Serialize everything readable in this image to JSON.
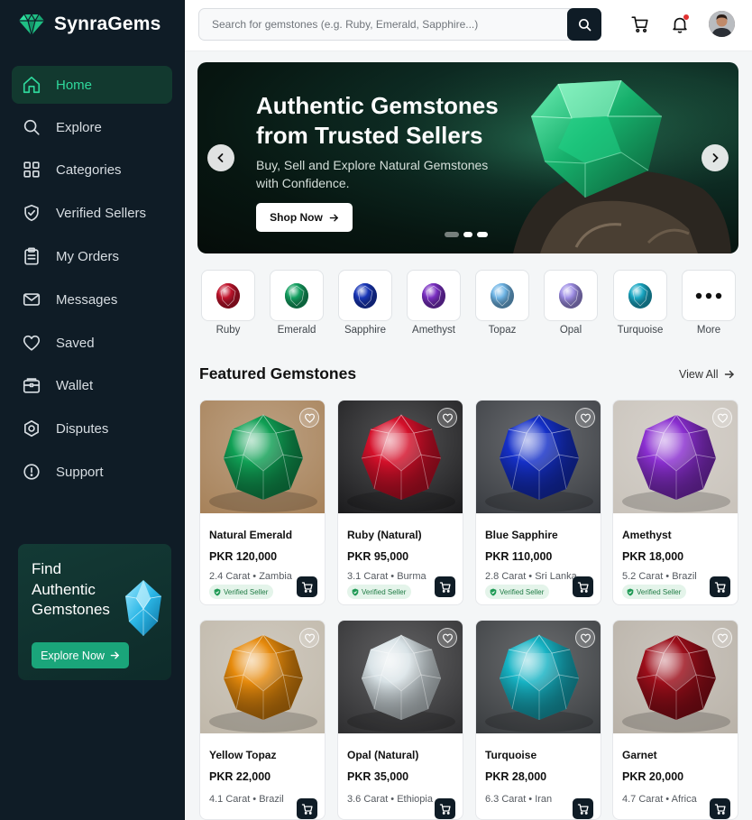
{
  "app": {
    "name": "SynraGems"
  },
  "sidebar": {
    "items": [
      {
        "label": "Home",
        "icon": "home-icon",
        "active": true
      },
      {
        "label": "Explore",
        "icon": "search-icon"
      },
      {
        "label": "Categories",
        "icon": "grid-icon"
      },
      {
        "label": "Verified Sellers",
        "icon": "shield-check-icon"
      },
      {
        "label": "My Orders",
        "icon": "clipboard-icon"
      },
      {
        "label": "Messages",
        "icon": "mail-icon"
      },
      {
        "label": "Saved",
        "icon": "heart-icon"
      },
      {
        "label": "Wallet",
        "icon": "wallet-icon"
      },
      {
        "label": "Disputes",
        "icon": "dispute-icon"
      },
      {
        "label": "Support",
        "icon": "info-icon"
      }
    ],
    "promo": {
      "title": "Find Authentic Gemstones",
      "button": "Explore Now"
    }
  },
  "header": {
    "search_placeholder": "Search for gemstones (e.g. Ruby, Emerald, Sapphire...)"
  },
  "hero": {
    "title": "Authentic Gemstones from Trusted Sellers",
    "subtitle": "Buy, Sell and Explore Natural Gemstones with Confidence.",
    "button": "Shop Now"
  },
  "categories": [
    {
      "label": "Ruby",
      "color": "#c0142c"
    },
    {
      "label": "Emerald",
      "color": "#14a061"
    },
    {
      "label": "Sapphire",
      "color": "#1836b8"
    },
    {
      "label": "Amethyst",
      "color": "#7a2fc2"
    },
    {
      "label": "Topaz",
      "color": "#6fb5e6"
    },
    {
      "label": "Opal",
      "color": "#9f8fe6"
    },
    {
      "label": "Turquoise",
      "color": "#1aa8c4"
    },
    {
      "label": "More",
      "color": "#111111"
    }
  ],
  "featured": {
    "title": "Featured Gemstones",
    "view_all": "View All",
    "products": [
      {
        "name": "Natural Emerald",
        "price": "PKR 120,000",
        "meta": "2.4 Carat • Zambia",
        "badge": "Verified Seller",
        "gem": "#10a055",
        "bg": "#a7825a"
      },
      {
        "name": "Ruby (Natural)",
        "price": "PKR 95,000",
        "meta": "3.1 Carat • Burma",
        "badge": "Verified Seller",
        "gem": "#d4102a",
        "bg": "#1c1c1e"
      },
      {
        "name": "Blue Sapphire",
        "price": "PKR 110,000",
        "meta": "2.8 Carat • Sri Lanka",
        "badge": "Verified Seller",
        "gem": "#1530c8",
        "bg": "#3a3d42"
      },
      {
        "name": "Amethyst",
        "price": "PKR 18,000",
        "meta": "5.2 Carat • Brazil",
        "badge": "Verified Seller",
        "gem": "#8a2fd0",
        "bg": "#c9c3bb"
      },
      {
        "name": "Yellow Topaz",
        "price": "PKR 22,000",
        "meta": "4.1 Carat • Brazil",
        "gem": "#e68a0c",
        "bg": "#c0b8aa"
      },
      {
        "name": "Opal (Natural)",
        "price": "PKR 35,000",
        "meta": "3.6 Carat • Ethiopia",
        "gem": "#d8e2e6",
        "bg": "#2f2f31"
      },
      {
        "name": "Turquoise",
        "price": "PKR 28,000",
        "meta": "6.3 Carat • Iran",
        "gem": "#17b3c4",
        "bg": "#3a3d40"
      },
      {
        "name": "Garnet",
        "price": "PKR 20,000",
        "meta": "4.7 Carat • Africa",
        "gem": "#9c0e1a",
        "bg": "#b9b2a8"
      }
    ]
  }
}
